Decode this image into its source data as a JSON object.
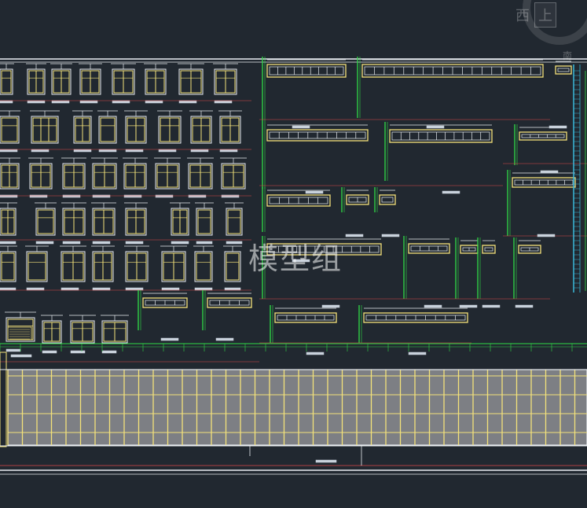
{
  "watermark": "模型组",
  "viewcube": {
    "west": "西",
    "top": "上",
    "south": "南"
  },
  "colors": {
    "background": "#212830",
    "frame": "#eaeef2",
    "window": "#f4e27a",
    "wall": "#2fdc46",
    "dim": "#e04848",
    "label": "#c9d2dc",
    "panel": "#7d7f84",
    "accent_bar": "#3ab8d8"
  },
  "glyphs": {
    "door_swing_symbol": "⇄",
    "mark_symbol": "⊥"
  }
}
